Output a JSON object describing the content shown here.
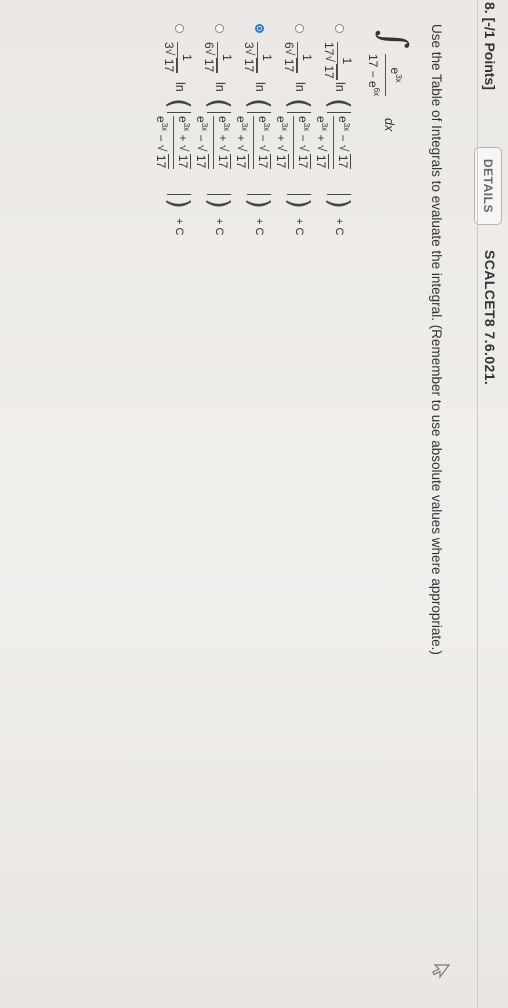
{
  "question": {
    "number": "8. [-/1 Points]",
    "details_label": "DETAILS",
    "code": "SCALCET8 7.6.021."
  },
  "instruction": "Use the Table of Integrals to evaluate the integral. (Remember to use absolute values where appropriate.)",
  "integral": {
    "numerator": "e",
    "numerator_exp": "3x",
    "denominator": "17 − e",
    "denominator_exp": "6x",
    "differential": "dx"
  },
  "answers": [
    {
      "coef_den_pre": "17",
      "radicand": "17",
      "ln": "ln",
      "num_sign": "−",
      "den_sign": "+",
      "plus_c": "+ C",
      "selected": false
    },
    {
      "coef_den_pre": "6",
      "radicand": "17",
      "ln": "ln",
      "num_sign": "−",
      "den_sign": "+",
      "plus_c": "+ C",
      "selected": false
    },
    {
      "coef_den_pre": "3",
      "radicand": "17",
      "ln": "ln",
      "num_sign": "−",
      "den_sign": "+",
      "plus_c": "+ C",
      "selected": true
    },
    {
      "coef_den_pre": "6",
      "radicand": "17",
      "ln": "ln",
      "num_sign": "+",
      "den_sign": "−",
      "plus_c": "+ C",
      "selected": false
    },
    {
      "coef_den_pre": "3",
      "radicand": "17",
      "ln": "ln",
      "num_sign": "+",
      "den_sign": "−",
      "plus_c": "+ C",
      "selected": false
    }
  ],
  "fraction_one": "1",
  "power_base": "e",
  "power_exp": "3x",
  "colors": {
    "accent": "#2a7bd0",
    "background": "#efece9"
  },
  "icons": {
    "cursor": "mouse-pointer-icon"
  }
}
